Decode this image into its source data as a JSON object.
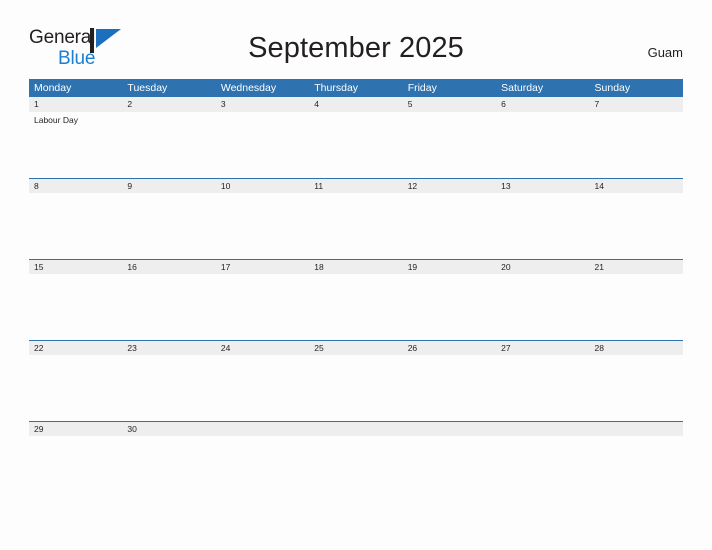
{
  "brand": {
    "name_part1": "General",
    "name_part2": "Blue",
    "logo_icon": "flag-triangle-icon",
    "color_dark": "#231f20",
    "color_blue": "#1b7fd4"
  },
  "header": {
    "title": "September 2025",
    "region": "Guam"
  },
  "calendar": {
    "header_bg": "#2e72b0",
    "band_bg": "#eeeeee",
    "weekdays": [
      "Monday",
      "Tuesday",
      "Wednesday",
      "Thursday",
      "Friday",
      "Saturday",
      "Sunday"
    ],
    "weeks": [
      {
        "days": [
          {
            "num": "1",
            "events": [
              "Labour Day"
            ]
          },
          {
            "num": "2",
            "events": []
          },
          {
            "num": "3",
            "events": []
          },
          {
            "num": "4",
            "events": []
          },
          {
            "num": "5",
            "events": []
          },
          {
            "num": "6",
            "events": []
          },
          {
            "num": "7",
            "events": []
          }
        ]
      },
      {
        "days": [
          {
            "num": "8",
            "events": []
          },
          {
            "num": "9",
            "events": []
          },
          {
            "num": "10",
            "events": []
          },
          {
            "num": "11",
            "events": []
          },
          {
            "num": "12",
            "events": []
          },
          {
            "num": "13",
            "events": []
          },
          {
            "num": "14",
            "events": []
          }
        ]
      },
      {
        "days": [
          {
            "num": "15",
            "events": []
          },
          {
            "num": "16",
            "events": []
          },
          {
            "num": "17",
            "events": []
          },
          {
            "num": "18",
            "events": []
          },
          {
            "num": "19",
            "events": []
          },
          {
            "num": "20",
            "events": []
          },
          {
            "num": "21",
            "events": []
          }
        ]
      },
      {
        "days": [
          {
            "num": "22",
            "events": []
          },
          {
            "num": "23",
            "events": []
          },
          {
            "num": "24",
            "events": []
          },
          {
            "num": "25",
            "events": []
          },
          {
            "num": "26",
            "events": []
          },
          {
            "num": "27",
            "events": []
          },
          {
            "num": "28",
            "events": []
          }
        ]
      },
      {
        "days": [
          {
            "num": "29",
            "events": []
          },
          {
            "num": "30",
            "events": []
          },
          {
            "num": "",
            "events": []
          },
          {
            "num": "",
            "events": []
          },
          {
            "num": "",
            "events": []
          },
          {
            "num": "",
            "events": []
          },
          {
            "num": "",
            "events": []
          }
        ]
      }
    ]
  }
}
